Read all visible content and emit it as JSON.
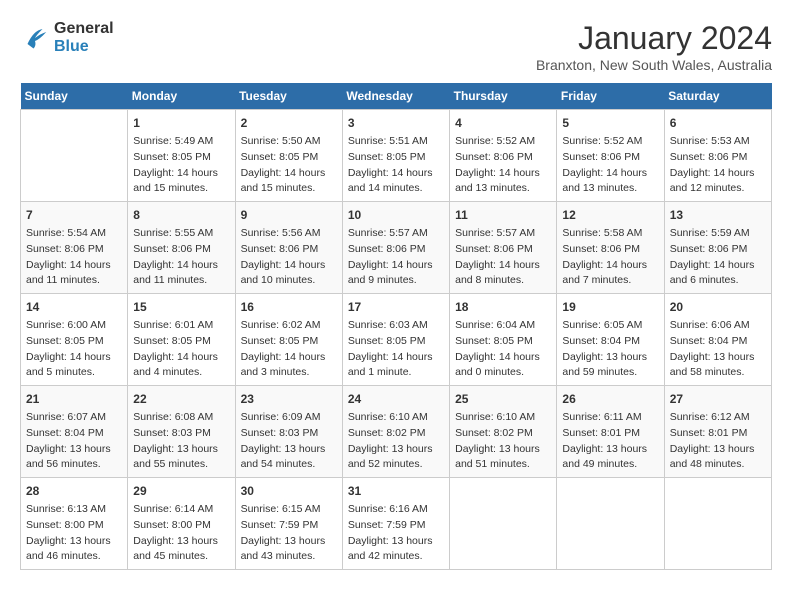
{
  "header": {
    "logo_line1": "General",
    "logo_line2": "Blue",
    "month_title": "January 2024",
    "location": "Branxton, New South Wales, Australia"
  },
  "days_of_week": [
    "Sunday",
    "Monday",
    "Tuesday",
    "Wednesday",
    "Thursday",
    "Friday",
    "Saturday"
  ],
  "weeks": [
    [
      {
        "day": "",
        "content": ""
      },
      {
        "day": "1",
        "content": "Sunrise: 5:49 AM\nSunset: 8:05 PM\nDaylight: 14 hours\nand 15 minutes."
      },
      {
        "day": "2",
        "content": "Sunrise: 5:50 AM\nSunset: 8:05 PM\nDaylight: 14 hours\nand 15 minutes."
      },
      {
        "day": "3",
        "content": "Sunrise: 5:51 AM\nSunset: 8:05 PM\nDaylight: 14 hours\nand 14 minutes."
      },
      {
        "day": "4",
        "content": "Sunrise: 5:52 AM\nSunset: 8:06 PM\nDaylight: 14 hours\nand 13 minutes."
      },
      {
        "day": "5",
        "content": "Sunrise: 5:52 AM\nSunset: 8:06 PM\nDaylight: 14 hours\nand 13 minutes."
      },
      {
        "day": "6",
        "content": "Sunrise: 5:53 AM\nSunset: 8:06 PM\nDaylight: 14 hours\nand 12 minutes."
      }
    ],
    [
      {
        "day": "7",
        "content": "Sunrise: 5:54 AM\nSunset: 8:06 PM\nDaylight: 14 hours\nand 11 minutes."
      },
      {
        "day": "8",
        "content": "Sunrise: 5:55 AM\nSunset: 8:06 PM\nDaylight: 14 hours\nand 11 minutes."
      },
      {
        "day": "9",
        "content": "Sunrise: 5:56 AM\nSunset: 8:06 PM\nDaylight: 14 hours\nand 10 minutes."
      },
      {
        "day": "10",
        "content": "Sunrise: 5:57 AM\nSunset: 8:06 PM\nDaylight: 14 hours\nand 9 minutes."
      },
      {
        "day": "11",
        "content": "Sunrise: 5:57 AM\nSunset: 8:06 PM\nDaylight: 14 hours\nand 8 minutes."
      },
      {
        "day": "12",
        "content": "Sunrise: 5:58 AM\nSunset: 8:06 PM\nDaylight: 14 hours\nand 7 minutes."
      },
      {
        "day": "13",
        "content": "Sunrise: 5:59 AM\nSunset: 8:06 PM\nDaylight: 14 hours\nand 6 minutes."
      }
    ],
    [
      {
        "day": "14",
        "content": "Sunrise: 6:00 AM\nSunset: 8:05 PM\nDaylight: 14 hours\nand 5 minutes."
      },
      {
        "day": "15",
        "content": "Sunrise: 6:01 AM\nSunset: 8:05 PM\nDaylight: 14 hours\nand 4 minutes."
      },
      {
        "day": "16",
        "content": "Sunrise: 6:02 AM\nSunset: 8:05 PM\nDaylight: 14 hours\nand 3 minutes."
      },
      {
        "day": "17",
        "content": "Sunrise: 6:03 AM\nSunset: 8:05 PM\nDaylight: 14 hours\nand 1 minute."
      },
      {
        "day": "18",
        "content": "Sunrise: 6:04 AM\nSunset: 8:05 PM\nDaylight: 14 hours\nand 0 minutes."
      },
      {
        "day": "19",
        "content": "Sunrise: 6:05 AM\nSunset: 8:04 PM\nDaylight: 13 hours\nand 59 minutes."
      },
      {
        "day": "20",
        "content": "Sunrise: 6:06 AM\nSunset: 8:04 PM\nDaylight: 13 hours\nand 58 minutes."
      }
    ],
    [
      {
        "day": "21",
        "content": "Sunrise: 6:07 AM\nSunset: 8:04 PM\nDaylight: 13 hours\nand 56 minutes."
      },
      {
        "day": "22",
        "content": "Sunrise: 6:08 AM\nSunset: 8:03 PM\nDaylight: 13 hours\nand 55 minutes."
      },
      {
        "day": "23",
        "content": "Sunrise: 6:09 AM\nSunset: 8:03 PM\nDaylight: 13 hours\nand 54 minutes."
      },
      {
        "day": "24",
        "content": "Sunrise: 6:10 AM\nSunset: 8:02 PM\nDaylight: 13 hours\nand 52 minutes."
      },
      {
        "day": "25",
        "content": "Sunrise: 6:10 AM\nSunset: 8:02 PM\nDaylight: 13 hours\nand 51 minutes."
      },
      {
        "day": "26",
        "content": "Sunrise: 6:11 AM\nSunset: 8:01 PM\nDaylight: 13 hours\nand 49 minutes."
      },
      {
        "day": "27",
        "content": "Sunrise: 6:12 AM\nSunset: 8:01 PM\nDaylight: 13 hours\nand 48 minutes."
      }
    ],
    [
      {
        "day": "28",
        "content": "Sunrise: 6:13 AM\nSunset: 8:00 PM\nDaylight: 13 hours\nand 46 minutes."
      },
      {
        "day": "29",
        "content": "Sunrise: 6:14 AM\nSunset: 8:00 PM\nDaylight: 13 hours\nand 45 minutes."
      },
      {
        "day": "30",
        "content": "Sunrise: 6:15 AM\nSunset: 7:59 PM\nDaylight: 13 hours\nand 43 minutes."
      },
      {
        "day": "31",
        "content": "Sunrise: 6:16 AM\nSunset: 7:59 PM\nDaylight: 13 hours\nand 42 minutes."
      },
      {
        "day": "",
        "content": ""
      },
      {
        "day": "",
        "content": ""
      },
      {
        "day": "",
        "content": ""
      }
    ]
  ]
}
